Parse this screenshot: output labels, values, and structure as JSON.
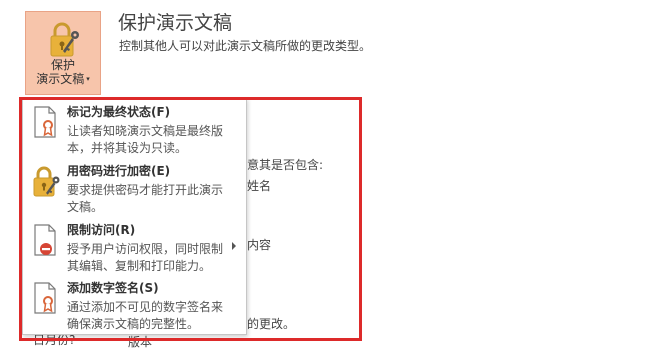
{
  "protect_button": {
    "line1": "保护",
    "line2": "演示文稿",
    "caret": "▾"
  },
  "section": {
    "title": "保护演示文稿",
    "description": "控制其他人可以对此演示文稿所做的更改类型。"
  },
  "background_text": {
    "line1": "意其是否包含:",
    "line2": "姓名",
    "line3": "内容",
    "line4": "的更改。",
    "line5": "日月份?",
    "line6": "版本"
  },
  "menu": {
    "items": [
      {
        "title": "标记为最终状态(F)",
        "description": "让读者知晓演示文稿是最终版\n本，并将其设为只读。",
        "icon": "document-ribbon-icon",
        "has_submenu": false
      },
      {
        "title": "用密码进行加密(E)",
        "description": "要求提供密码才能打开此演示\n文稿。",
        "icon": "lock-key-icon",
        "has_submenu": false
      },
      {
        "title": "限制访问(R)",
        "description": "授予用户访问权限，同时限制\n其编辑、复制和打印能力。",
        "icon": "document-restrict-icon",
        "has_submenu": true
      },
      {
        "title": "添加数字签名(S)",
        "description": "通过添加不可见的数字签名来\n确保演示文稿的完整性。",
        "icon": "document-ribbon-icon",
        "has_submenu": false
      }
    ]
  },
  "colors": {
    "protect_button_bg": "#f7c5ab",
    "highlight_border": "#dd2a2a",
    "lock_gold": "#e8b13a",
    "ribbon_orange": "#d9663a"
  }
}
